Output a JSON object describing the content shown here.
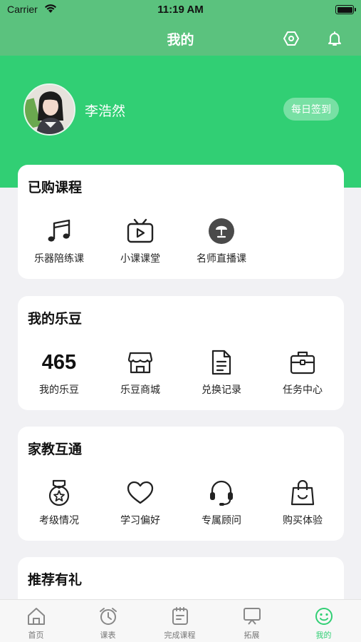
{
  "status_bar": {
    "carrier": "Carrier",
    "time": "11:19 AM"
  },
  "nav": {
    "title": "我的",
    "settings_icon": "settings-hex-icon",
    "bell_icon": "bell-icon"
  },
  "profile": {
    "username": "李浩然",
    "checkin_label": "每日签到"
  },
  "purchased": {
    "title": "已购课程",
    "items": [
      {
        "label": "乐器陪练课",
        "icon": "music-note-icon"
      },
      {
        "label": "小课课堂",
        "icon": "tv-icon"
      },
      {
        "label": "名师直播课",
        "icon": "lamp-icon"
      }
    ]
  },
  "ledou": {
    "title": "我的乐豆",
    "count": "465",
    "count_label": "我的乐豆",
    "items": [
      {
        "label": "乐豆商城",
        "icon": "store-icon"
      },
      {
        "label": "兑换记录",
        "icon": "document-icon"
      },
      {
        "label": "任务中心",
        "icon": "briefcase-icon"
      }
    ]
  },
  "home_school": {
    "title": "家教互通",
    "items": [
      {
        "label": "考级情况",
        "icon": "medal-icon"
      },
      {
        "label": "学习偏好",
        "icon": "heart-icon"
      },
      {
        "label": "专属顾问",
        "icon": "headset-icon"
      },
      {
        "label": "购买体验",
        "icon": "shopping-bag-icon"
      }
    ]
  },
  "referral": {
    "title": "推荐有礼"
  },
  "tabbar": {
    "items": [
      {
        "label": "首页",
        "icon": "home-icon"
      },
      {
        "label": "课表",
        "icon": "alarm-clock-icon"
      },
      {
        "label": "完成课程",
        "icon": "notepad-icon"
      },
      {
        "label": "拓展",
        "icon": "board-icon"
      },
      {
        "label": "我的",
        "icon": "smiley-icon"
      }
    ],
    "active_index": 4,
    "active_color": "#31cf74"
  },
  "colors": {
    "brand_green": "#31cf74",
    "header_green": "#5bc27e",
    "background": "#f1f1f4"
  }
}
